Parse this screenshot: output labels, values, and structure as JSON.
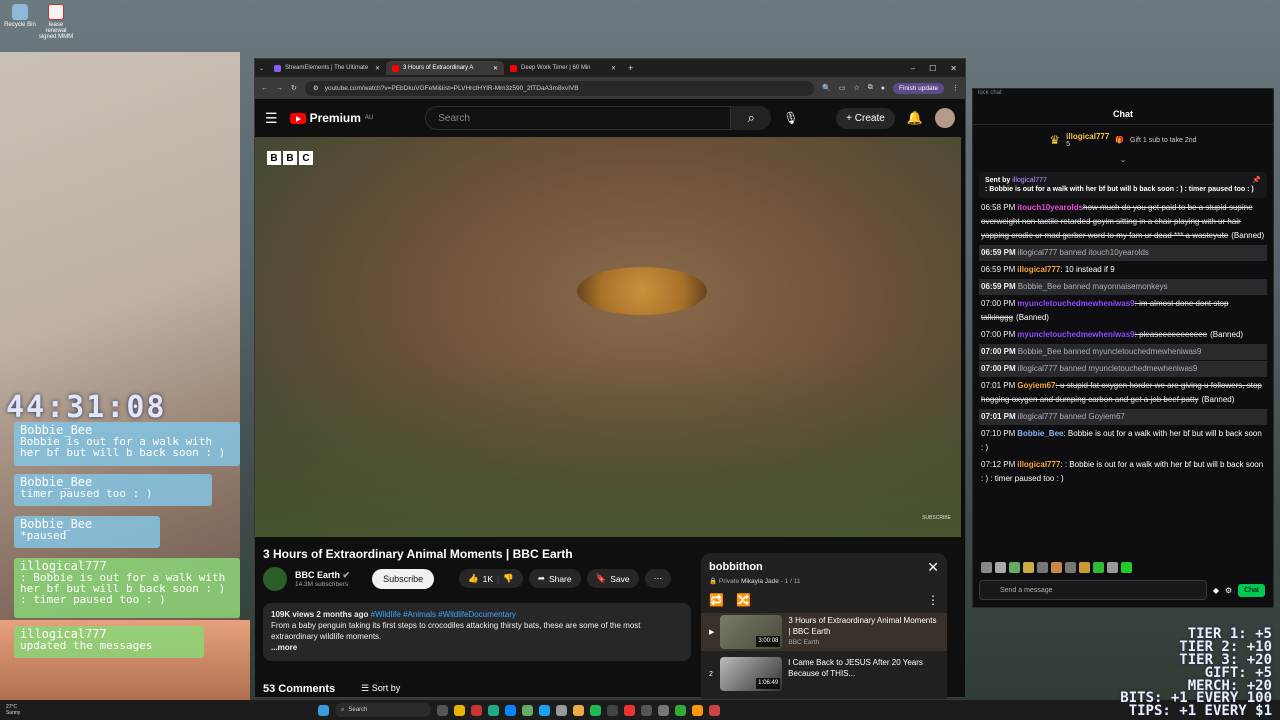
{
  "desktop": {
    "icons": [
      {
        "label": "Recycle Bin"
      },
      {
        "label": "lease renewal signed MMM"
      }
    ]
  },
  "overlay": {
    "timer": "44:31:08",
    "bubbles": [
      {
        "user": "Bobbie_Bee",
        "text": "Bobbie is out for a walk with her bf but will b back soon : )"
      },
      {
        "user": "Bobbie_Bee",
        "text": "timer paused too : )"
      },
      {
        "user": "Bobbie_Bee",
        "text": "*paused"
      },
      {
        "user": "illogical777",
        "text": ": Bobbie is out for a walk with her bf but will b back soon : ) : timer paused too : )"
      },
      {
        "user": "illogical777",
        "text": "updated the messages"
      }
    ],
    "tiers": [
      "TIER 1: +5",
      "TIER 2: +10",
      "TIER 3: +20",
      "GIFT: +5",
      "MERCH: +20"
    ],
    "bits_tips": [
      "BITS: +1 EVERY 100",
      "TIPS: +1 EVERY $1"
    ]
  },
  "browser": {
    "tabs": [
      {
        "title": "StreamElements | The Ultimate",
        "active": false
      },
      {
        "title": "3 Hours of Extraordinary A",
        "active": true
      },
      {
        "title": "Deep Work Timer | 60 Min",
        "active": false
      }
    ],
    "url": "youtube.com/watch?v=PEbDkuVGFeM&list=PLVHrctHYlR-Mm3z590_2fTDaA3m8xvIVB",
    "finish_update": "Finish update"
  },
  "youtube": {
    "logo": "Premium",
    "logo_region": "AU",
    "search_placeholder": "Search",
    "create_label": "Create",
    "watermark": "SUBSCRIBE",
    "bbc_letters": [
      "B",
      "B",
      "C"
    ],
    "video_title": "3 Hours of Extraordinary Animal Moments | BBC Earth",
    "channel_name": "BBC Earth",
    "channel_subs": "14.3M subscribers",
    "subscribe_label": "Subscribe",
    "likes": "1K",
    "share_label": "Share",
    "save_label": "Save",
    "views": "109K views",
    "uploaded": "2 months ago",
    "tags": "#Wildlife #Animals #WildlifeDocumentary",
    "description": "From a baby penguin taking its first steps to crocodiles attacking thirsty bats, these are some of the most extraordinary wildlife moments.",
    "more_label": "...more",
    "comments_count": "53 Comments",
    "sort_label": "Sort by"
  },
  "playlist": {
    "title": "bobbithon",
    "privacy": "Private",
    "owner": "Mikayla Jade",
    "position": "1 / 11",
    "items": [
      {
        "index": "",
        "title": "3 Hours of Extraordinary Animal Moments | BBC Earth",
        "channel": "BBC Earth",
        "duration": "3:00:08"
      },
      {
        "index": "2",
        "title": "I Came Back to JESUS After 20 Years Because of THIS...",
        "channel": "",
        "duration": "1:06:49"
      }
    ]
  },
  "chat": {
    "popup_label": "lock chat",
    "header": "Chat",
    "gift_user": "illogical777",
    "gift_count": "5",
    "gift_text": "Gift 1 sub to take 2nd",
    "pinned_label": "Sent by",
    "pinned_user": "illogical777",
    "pinned_text": ": Bobbie is out for a walk with her bf but will b back soon : ) : timer paused too : )",
    "messages": [
      {
        "type": "deleted",
        "ts": "06:58 PM",
        "user": "itouch10yearolds",
        "ucls": "u-pink",
        "text": "how much do you get paid to be a stupid supine overweight non tactile retarded goyim sitting in a chair playing with ur hair yapping crodie ur mad gerber word to my fam ur dead *** a wasteyute",
        "suffix": "(Banned)"
      },
      {
        "type": "sys",
        "ts": "06:59 PM",
        "text": "illogical777 banned itouch10yearolds"
      },
      {
        "type": "msg",
        "ts": "06:59 PM",
        "user": "illogical777",
        "ucls": "u-or",
        "text": ": 10 instead if 9",
        "suffix": ""
      },
      {
        "type": "sys",
        "ts": "06:59 PM",
        "text": "Bobbie_Bee banned mayonnaisemonkeys"
      },
      {
        "type": "deleted",
        "ts": "07:00 PM",
        "user": "myuncletouchedmewheniwas9",
        "ucls": "u-pur",
        "text": ": im almost done dont stop talkinggg",
        "suffix": "(Banned)"
      },
      {
        "type": "deleted",
        "ts": "07:00 PM",
        "user": "myuncletouchedmewheniwas9",
        "ucls": "u-pur",
        "text": ": pleaseeeeeeeeeee",
        "suffix": "(Banned)"
      },
      {
        "type": "sys",
        "ts": "07:00 PM",
        "text": "Bobbie_Bee banned myuncletouchedmewheniwas9"
      },
      {
        "type": "sys",
        "ts": "07:00 PM",
        "text": "illogical777 banned myuncletouchedmewheniwas9"
      },
      {
        "type": "deleted",
        "ts": "07:01 PM",
        "user": "Goyiem67",
        "ucls": "u-or",
        "text": ": u stupid fat oxygen horder we are giving u followers, stop hogging oxygen and dumping carbon and get a job beef patty",
        "suffix": "(Banned)"
      },
      {
        "type": "sys",
        "ts": "07:01 PM",
        "text": "illogical777 banned Goyiem67"
      },
      {
        "type": "msg",
        "ts": "07:10 PM",
        "user": "Bobbie_Bee",
        "ucls": "u-blue",
        "text": ": Bobbie is out for a walk with her bf but will b back soon : )",
        "suffix": ""
      },
      {
        "type": "msg",
        "ts": "07:12 PM",
        "user": "illogical777",
        "ucls": "u-or",
        "text": ": : Bobbie is out for a walk with her bf but will b back soon : ) : timer paused too : )",
        "suffix": ""
      }
    ],
    "input_placeholder": "Send a message",
    "send_label": "Chat"
  },
  "taskbar": {
    "weather_temp": "27°C",
    "weather_desc": "Sunny",
    "search_label": "Search"
  }
}
